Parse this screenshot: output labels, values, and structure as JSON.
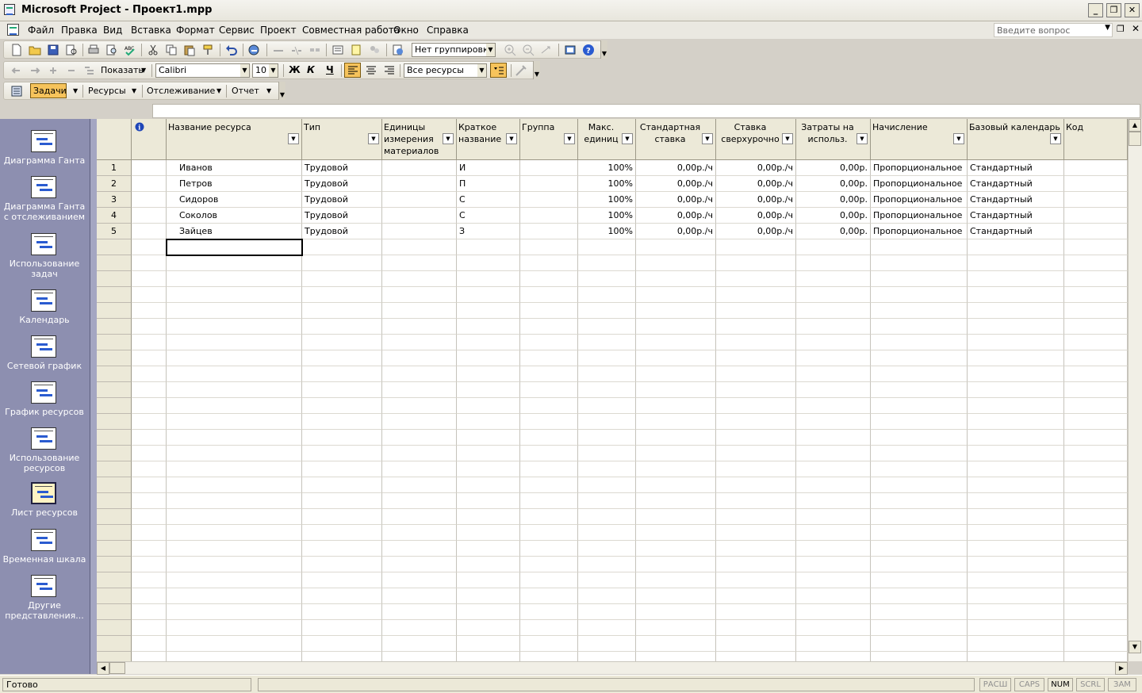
{
  "window": {
    "title": "Microsoft Project - Проект1.mpp"
  },
  "menu": {
    "items": [
      "Файл",
      "Правка",
      "Вид",
      "Вставка",
      "Формат",
      "Сервис",
      "Проект",
      "Совместная работа",
      "Окно",
      "Справка"
    ],
    "ask_placeholder": "Введите вопрос"
  },
  "toolbar_standard": {
    "grouping": "Нет группировки"
  },
  "toolbar_formatting": {
    "show_label": "Показать",
    "font": "Calibri",
    "size": "10",
    "bold": "Ж",
    "italic": "К",
    "underline": "Ч",
    "filter": "Все ресурсы"
  },
  "toolbar_guide": {
    "tasks": "Задачи",
    "resources": "Ресурсы",
    "tracking": "Отслеживание",
    "report": "Отчет"
  },
  "viewbar": {
    "items": [
      [
        "Диаграмма Ганта"
      ],
      [
        "Диаграмма Ганта",
        "с отслеживанием"
      ],
      [
        "Использование",
        "задач"
      ],
      [
        "Календарь"
      ],
      [
        "Сетевой график"
      ],
      [
        "График ресурсов"
      ],
      [
        "Использование",
        "ресурсов"
      ],
      [
        "Лист ресурсов"
      ],
      [
        "Временная шкала"
      ],
      [
        "Другие",
        "представления..."
      ]
    ]
  },
  "sheet": {
    "headers": [
      [
        "Название ресурса"
      ],
      [
        "Тип"
      ],
      [
        "Единицы",
        "измерения",
        "материалов"
      ],
      [
        "Краткое",
        "название"
      ],
      [
        "Группа"
      ],
      [
        "Макс.",
        "единиц"
      ],
      [
        "Стандартная",
        "ставка"
      ],
      [
        "Ставка",
        "сверхурочно"
      ],
      [
        "Затраты на",
        "использ."
      ],
      [
        "Начисление"
      ],
      [
        "Базовый календарь"
      ],
      [
        "Код"
      ]
    ],
    "rows": [
      {
        "id": "1",
        "name": "Иванов",
        "type": "Трудовой",
        "material": "",
        "initials": "И",
        "group": "",
        "max_units": "100%",
        "std_rate": "0,00р./ч",
        "ovt_rate": "0,00р./ч",
        "cost_use": "0,00р.",
        "accrue": "Пропорциональное",
        "calendar": "Стандартный",
        "code": ""
      },
      {
        "id": "2",
        "name": "Петров",
        "type": "Трудовой",
        "material": "",
        "initials": "П",
        "group": "",
        "max_units": "100%",
        "std_rate": "0,00р./ч",
        "ovt_rate": "0,00р./ч",
        "cost_use": "0,00р.",
        "accrue": "Пропорциональное",
        "calendar": "Стандартный",
        "code": ""
      },
      {
        "id": "3",
        "name": "Сидоров",
        "type": "Трудовой",
        "material": "",
        "initials": "С",
        "group": "",
        "max_units": "100%",
        "std_rate": "0,00р./ч",
        "ovt_rate": "0,00р./ч",
        "cost_use": "0,00р.",
        "accrue": "Пропорциональное",
        "calendar": "Стандартный",
        "code": ""
      },
      {
        "id": "4",
        "name": "Соколов",
        "type": "Трудовой",
        "material": "",
        "initials": "С",
        "group": "",
        "max_units": "100%",
        "std_rate": "0,00р./ч",
        "ovt_rate": "0,00р./ч",
        "cost_use": "0,00р.",
        "accrue": "Пропорциональное",
        "calendar": "Стандартный",
        "code": ""
      },
      {
        "id": "5",
        "name": "Зайцев",
        "type": "Трудовой",
        "material": "",
        "initials": "З",
        "group": "",
        "max_units": "100%",
        "std_rate": "0,00р./ч",
        "ovt_rate": "0,00р./ч",
        "cost_use": "0,00р.",
        "accrue": "Пропорциональное",
        "calendar": "Стандартный",
        "code": ""
      }
    ]
  },
  "status": {
    "text": "Готово",
    "indicators": [
      "РАСШ",
      "CAPS",
      "NUM",
      "SCRL",
      "ЗАМ"
    ]
  },
  "colors": {
    "viewbar_bg": "#8d8fb0",
    "active_button": "#f6c35b"
  }
}
